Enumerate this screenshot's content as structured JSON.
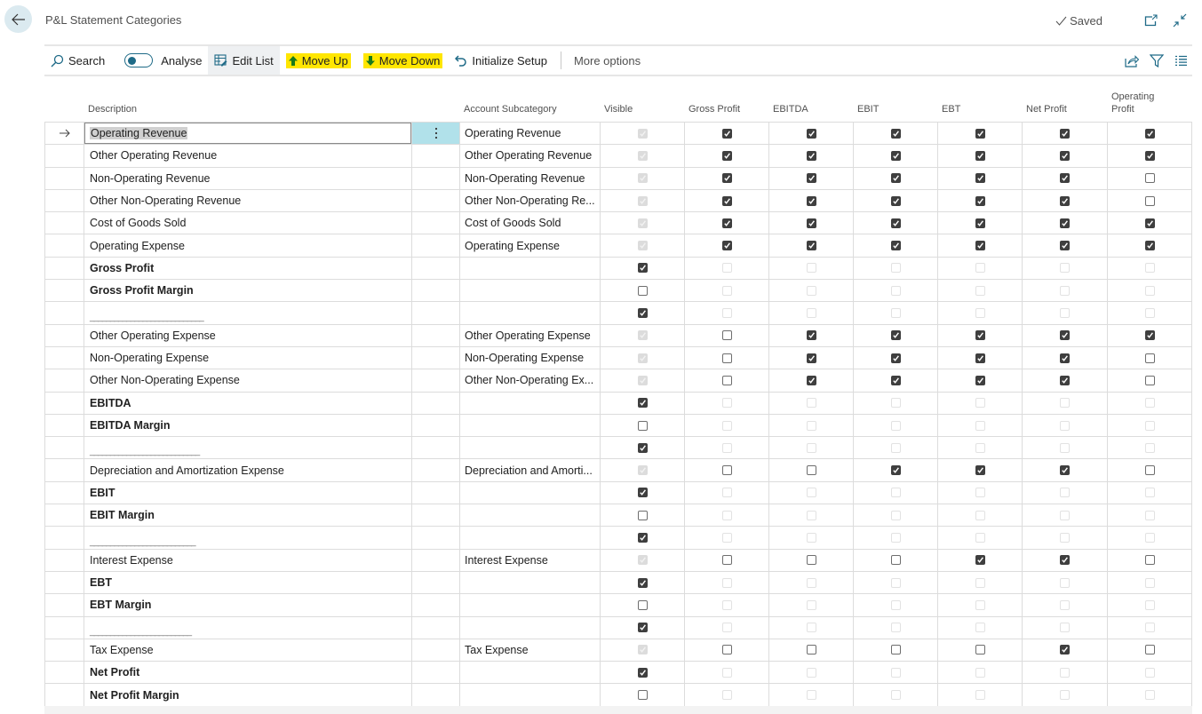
{
  "header": {
    "title": "P&L Statement Categories",
    "saved_label": "Saved",
    "back_icon": "arrow-left-icon",
    "open_new_window_icon": "open-in-new-icon",
    "collapse_icon": "collapse-icon"
  },
  "toolbar": {
    "search_label": "Search",
    "analyse_label": "Analyse",
    "analyse_toggle_on": false,
    "edit_list_label": "Edit List",
    "move_up_label": "Move Up",
    "move_down_label": "Move Down",
    "initialize_setup_label": "Initialize Setup",
    "more_options_label": "More options",
    "highlight_color": "#ffe600",
    "arrow_color": "#1a7a1a",
    "accent_color": "#1e6a87"
  },
  "grid": {
    "columns": {
      "description": "Description",
      "account_subcategory": "Account Subcategory",
      "visible": "Visible",
      "gross_profit": "Gross Profit",
      "ebitda": "EBITDA",
      "ebit": "EBIT",
      "ebt": "EBT",
      "net_profit": "Net Profit",
      "operating_profit": "Operating Profit"
    },
    "rows": [
      {
        "description": "Operating Revenue",
        "subcategory": "Operating Revenue",
        "bold": false,
        "selected": true,
        "visible": "dis-on",
        "flags": [
          "on",
          "on",
          "on",
          "on",
          "on",
          "on"
        ]
      },
      {
        "description": "Other Operating Revenue",
        "subcategory": "Other Operating Revenue",
        "bold": false,
        "visible": "dis-on",
        "flags": [
          "on",
          "on",
          "on",
          "on",
          "on",
          "on"
        ]
      },
      {
        "description": "Non-Operating Revenue",
        "subcategory": "Non-Operating Revenue",
        "bold": false,
        "visible": "dis-on",
        "flags": [
          "on",
          "on",
          "on",
          "on",
          "on",
          "off"
        ]
      },
      {
        "description": "Other Non-Operating Revenue",
        "subcategory": "Other Non-Operating Re...",
        "bold": false,
        "visible": "dis-on",
        "flags": [
          "on",
          "on",
          "on",
          "on",
          "on",
          "off"
        ]
      },
      {
        "description": "Cost of Goods Sold",
        "subcategory": "Cost of Goods Sold",
        "bold": false,
        "visible": "dis-on",
        "flags": [
          "on",
          "on",
          "on",
          "on",
          "on",
          "on"
        ]
      },
      {
        "description": "Operating Expense",
        "subcategory": "Operating Expense",
        "bold": false,
        "visible": "dis-on",
        "flags": [
          "on",
          "on",
          "on",
          "on",
          "on",
          "on"
        ]
      },
      {
        "description": "Gross Profit",
        "subcategory": "",
        "bold": true,
        "visible": "on",
        "flags": [
          "dis-off",
          "dis-off",
          "dis-off",
          "dis-off",
          "dis-off",
          "dis-off"
        ]
      },
      {
        "description": "Gross Profit Margin",
        "subcategory": "",
        "bold": true,
        "visible": "off",
        "flags": [
          "dis-off",
          "dis-off",
          "dis-off",
          "dis-off",
          "dis-off",
          "dis-off"
        ]
      },
      {
        "description": "____________________________",
        "subcategory": "",
        "bold": false,
        "separator": true,
        "visible": "on",
        "flags": [
          "dis-off",
          "dis-off",
          "dis-off",
          "dis-off",
          "dis-off",
          "dis-off"
        ]
      },
      {
        "description": "Other Operating Expense",
        "subcategory": "Other Operating Expense",
        "bold": false,
        "visible": "dis-on",
        "flags": [
          "off",
          "on",
          "on",
          "on",
          "on",
          "on"
        ]
      },
      {
        "description": "Non-Operating Expense",
        "subcategory": "Non-Operating Expense",
        "bold": false,
        "visible": "dis-on",
        "flags": [
          "off",
          "on",
          "on",
          "on",
          "on",
          "off"
        ]
      },
      {
        "description": "Other Non-Operating Expense",
        "subcategory": "Other Non-Operating Ex...",
        "bold": false,
        "visible": "dis-on",
        "flags": [
          "off",
          "on",
          "on",
          "on",
          "on",
          "off"
        ]
      },
      {
        "description": "EBITDA",
        "subcategory": "",
        "bold": true,
        "visible": "on",
        "flags": [
          "dis-off",
          "dis-off",
          "dis-off",
          "dis-off",
          "dis-off",
          "dis-off"
        ]
      },
      {
        "description": "EBITDA Margin",
        "subcategory": "",
        "bold": true,
        "visible": "off",
        "flags": [
          "dis-off",
          "dis-off",
          "dis-off",
          "dis-off",
          "dis-off",
          "dis-off"
        ]
      },
      {
        "description": "___________________________",
        "subcategory": "",
        "bold": false,
        "separator": true,
        "visible": "on",
        "flags": [
          "dis-off",
          "dis-off",
          "dis-off",
          "dis-off",
          "dis-off",
          "dis-off"
        ]
      },
      {
        "description": "Depreciation and Amortization Expense",
        "subcategory": "Depreciation and Amorti...",
        "bold": false,
        "visible": "dis-on",
        "flags": [
          "off",
          "off",
          "on",
          "on",
          "on",
          "off"
        ]
      },
      {
        "description": "EBIT",
        "subcategory": "",
        "bold": true,
        "visible": "on",
        "flags": [
          "dis-off",
          "dis-off",
          "dis-off",
          "dis-off",
          "dis-off",
          "dis-off"
        ]
      },
      {
        "description": "EBIT Margin",
        "subcategory": "",
        "bold": true,
        "visible": "off",
        "flags": [
          "dis-off",
          "dis-off",
          "dis-off",
          "dis-off",
          "dis-off",
          "dis-off"
        ]
      },
      {
        "description": "__________________________",
        "subcategory": "",
        "bold": false,
        "separator": true,
        "visible": "on",
        "flags": [
          "dis-off",
          "dis-off",
          "dis-off",
          "dis-off",
          "dis-off",
          "dis-off"
        ]
      },
      {
        "description": "Interest Expense",
        "subcategory": "Interest Expense",
        "bold": false,
        "visible": "dis-on",
        "flags": [
          "off",
          "off",
          "off",
          "on",
          "on",
          "off"
        ]
      },
      {
        "description": "EBT",
        "subcategory": "",
        "bold": true,
        "visible": "on",
        "flags": [
          "dis-off",
          "dis-off",
          "dis-off",
          "dis-off",
          "dis-off",
          "dis-off"
        ]
      },
      {
        "description": "EBT Margin",
        "subcategory": "",
        "bold": true,
        "visible": "off",
        "flags": [
          "dis-off",
          "dis-off",
          "dis-off",
          "dis-off",
          "dis-off",
          "dis-off"
        ]
      },
      {
        "description": "_________________________",
        "subcategory": "",
        "bold": false,
        "separator": true,
        "visible": "on",
        "flags": [
          "dis-off",
          "dis-off",
          "dis-off",
          "dis-off",
          "dis-off",
          "dis-off"
        ]
      },
      {
        "description": "Tax Expense",
        "subcategory": "Tax Expense",
        "bold": false,
        "visible": "dis-on",
        "flags": [
          "off",
          "off",
          "off",
          "off",
          "on",
          "off"
        ]
      },
      {
        "description": "Net Profit",
        "subcategory": "",
        "bold": true,
        "visible": "on",
        "flags": [
          "dis-off",
          "dis-off",
          "dis-off",
          "dis-off",
          "dis-off",
          "dis-off"
        ]
      },
      {
        "description": "Net Profit Margin",
        "subcategory": "",
        "bold": true,
        "visible": "off",
        "flags": [
          "dis-off",
          "dis-off",
          "dis-off",
          "dis-off",
          "dis-off",
          "dis-off"
        ]
      }
    ]
  }
}
